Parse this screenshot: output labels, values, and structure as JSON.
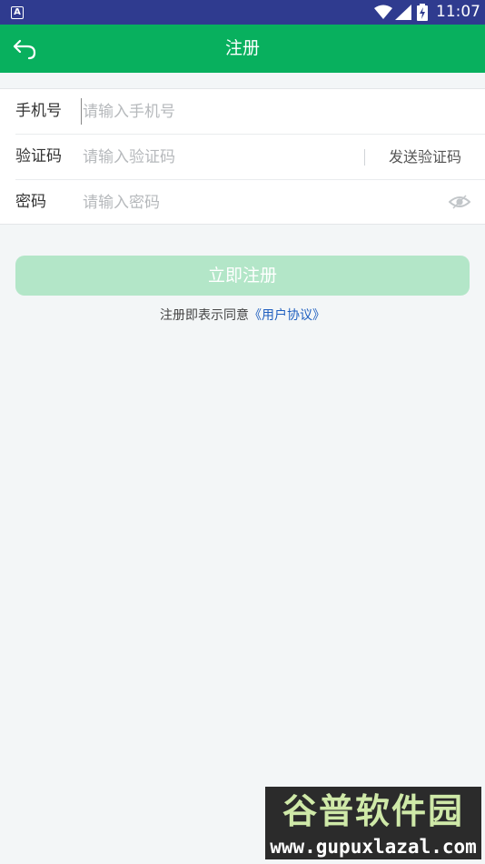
{
  "status_bar": {
    "app_icon_letter": "A",
    "time": "11:07",
    "icons": [
      "wifi-icon",
      "signal-icon",
      "battery-charging-icon"
    ]
  },
  "app_bar": {
    "title": "注册",
    "back_icon": "back-arrow-icon",
    "color": "#08b05e"
  },
  "form": {
    "phone": {
      "label": "手机号",
      "placeholder": "请输入手机号",
      "value": ""
    },
    "code": {
      "label": "验证码",
      "placeholder": "请输入验证码",
      "value": "",
      "send_label": "发送验证码"
    },
    "password": {
      "label": "密码",
      "placeholder": "请输入密码",
      "value": "",
      "toggle_icon": "eye-icon"
    }
  },
  "register_button": {
    "label": "立即注册",
    "color": "#b3e6c8"
  },
  "agreement": {
    "text": "注册即表示同意",
    "link": "《用户协议》"
  },
  "watermark": {
    "title": "谷普软件园",
    "url": "www.gupuxlazal.com"
  }
}
